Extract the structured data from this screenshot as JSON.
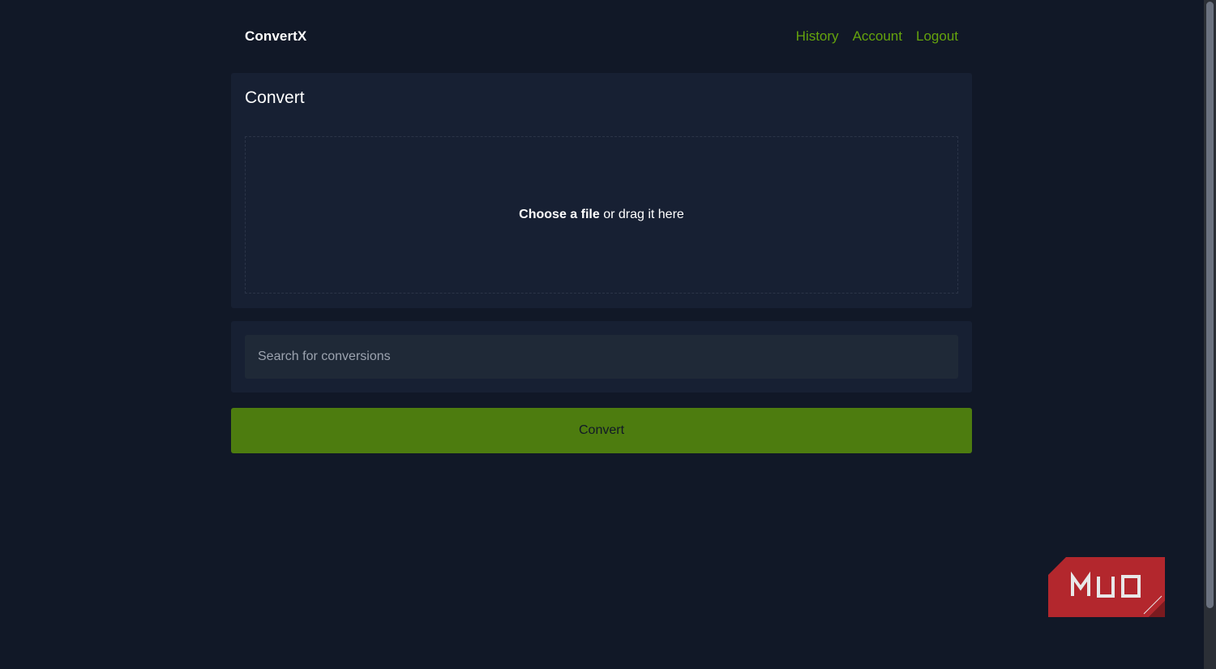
{
  "header": {
    "brand": "ConvertX",
    "nav": {
      "history": "History",
      "account": "Account",
      "logout": "Logout"
    }
  },
  "convert_card": {
    "title": "Convert",
    "dropzone": {
      "choose_label": "Choose a file",
      "drag_label": " or drag it here"
    }
  },
  "search": {
    "placeholder": "Search for conversions",
    "value": ""
  },
  "convert_button": {
    "label": "Convert"
  },
  "watermark": {
    "text": "MUO"
  },
  "colors": {
    "background": "#111827",
    "card": "#172033",
    "accent": "#65a30d",
    "button": "#4d7c0f"
  }
}
